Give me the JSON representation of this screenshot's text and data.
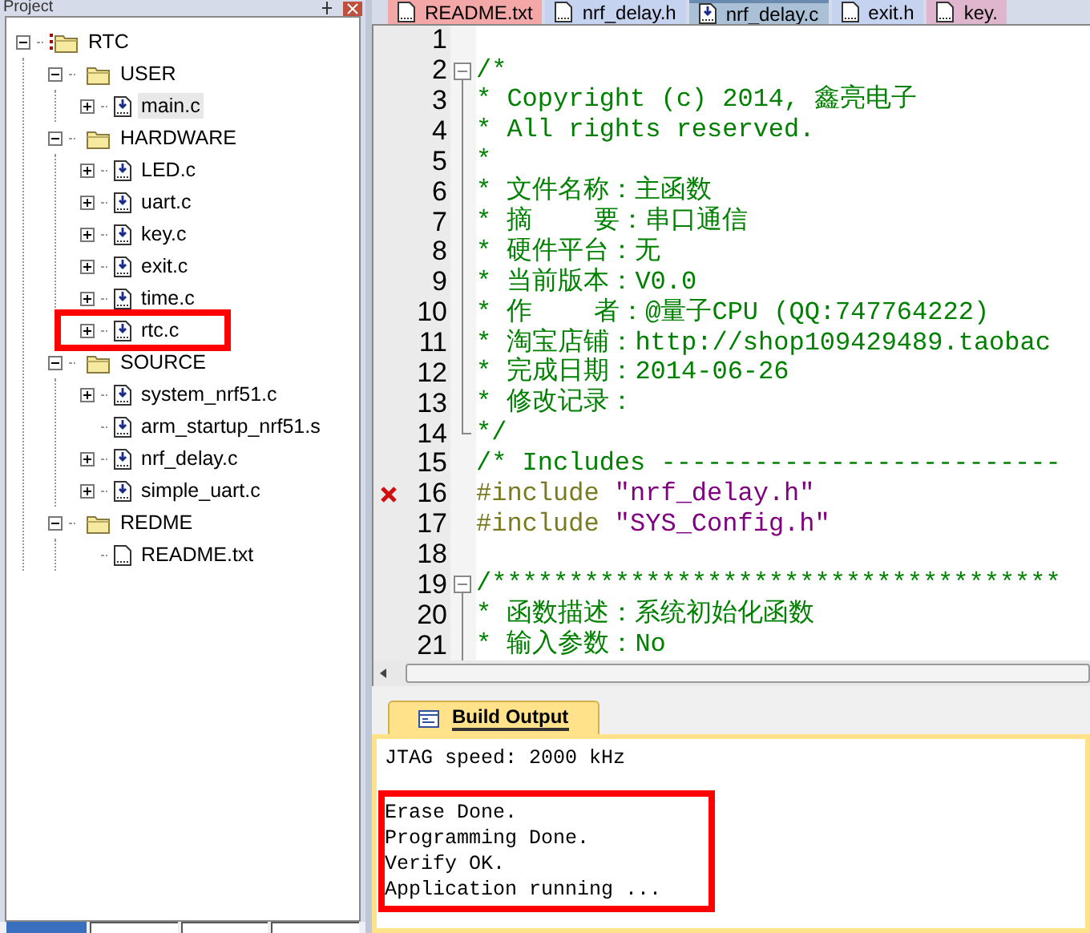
{
  "project_panel": {
    "title": "Project",
    "tree": [
      {
        "label": "RTC",
        "kind": "project",
        "expandable": true,
        "expanded": true,
        "selected": false,
        "annotated": false,
        "children": [
          {
            "label": "USER",
            "kind": "folder",
            "expandable": true,
            "expanded": true,
            "selected": false,
            "annotated": false,
            "children": [
              {
                "label": "main.c",
                "kind": "source",
                "expandable": true,
                "expanded": false,
                "selected": true,
                "annotated": false
              }
            ]
          },
          {
            "label": "HARDWARE",
            "kind": "folder",
            "expandable": true,
            "expanded": true,
            "selected": false,
            "annotated": false,
            "children": [
              {
                "label": "LED.c",
                "kind": "source",
                "expandable": true,
                "expanded": false,
                "selected": false,
                "annotated": false
              },
              {
                "label": "uart.c",
                "kind": "source",
                "expandable": true,
                "expanded": false,
                "selected": false,
                "annotated": false
              },
              {
                "label": "key.c",
                "kind": "source",
                "expandable": true,
                "expanded": false,
                "selected": false,
                "annotated": false
              },
              {
                "label": "exit.c",
                "kind": "source",
                "expandable": true,
                "expanded": false,
                "selected": false,
                "annotated": false
              },
              {
                "label": "time.c",
                "kind": "source",
                "expandable": true,
                "expanded": false,
                "selected": false,
                "annotated": false
              },
              {
                "label": "rtc.c",
                "kind": "source",
                "expandable": true,
                "expanded": false,
                "selected": false,
                "annotated": true
              }
            ]
          },
          {
            "label": "SOURCE",
            "kind": "folder",
            "expandable": true,
            "expanded": true,
            "selected": false,
            "annotated": false,
            "children": [
              {
                "label": "system_nrf51.c",
                "kind": "source",
                "expandable": true,
                "expanded": false,
                "selected": false,
                "annotated": false
              },
              {
                "label": "arm_startup_nrf51.s",
                "kind": "source",
                "expandable": false,
                "selected": false,
                "annotated": false
              },
              {
                "label": "nrf_delay.c",
                "kind": "source",
                "expandable": true,
                "expanded": false,
                "selected": false,
                "annotated": false
              },
              {
                "label": "simple_uart.c",
                "kind": "source",
                "expandable": true,
                "expanded": false,
                "selected": false,
                "annotated": false
              }
            ]
          },
          {
            "label": "REDME",
            "kind": "folder",
            "expandable": true,
            "expanded": true,
            "selected": false,
            "annotated": false,
            "children": [
              {
                "label": "README.txt",
                "kind": "text",
                "expandable": false,
                "selected": false,
                "annotated": false
              }
            ]
          }
        ]
      }
    ]
  },
  "editor": {
    "tabs": [
      {
        "label": "README.txt",
        "kind": "text",
        "selected": false,
        "color": "#f4a7a7"
      },
      {
        "label": "nrf_delay.h",
        "kind": "text",
        "selected": false,
        "color": "#c5d3f0"
      },
      {
        "label": "nrf_delay.c",
        "kind": "source",
        "selected": true,
        "color": "#a9c0d6"
      },
      {
        "label": "exit.h",
        "kind": "text",
        "selected": false,
        "color": "#c5d3f0"
      },
      {
        "label": "key.",
        "kind": "text",
        "selected": false,
        "color": "#e0b6cf"
      }
    ],
    "lines": [
      {
        "number": "1",
        "kind": "blank",
        "fold_start": false,
        "fold_body": false,
        "fold_end": false,
        "error": false
      },
      {
        "number": "2",
        "kind": "comment",
        "text": "/*",
        "fold_start": true,
        "fold_body": false,
        "fold_end": false,
        "error": false
      },
      {
        "number": "3",
        "kind": "comment",
        "text": "* Copyright (c) 2014, 鑫亮电子",
        "fold_start": false,
        "fold_body": true,
        "fold_end": false,
        "error": false
      },
      {
        "number": "4",
        "kind": "comment",
        "text": "* All rights reserved.",
        "fold_start": false,
        "fold_body": true,
        "fold_end": false,
        "error": false
      },
      {
        "number": "5",
        "kind": "comment",
        "text": "*",
        "fold_start": false,
        "fold_body": true,
        "fold_end": false,
        "error": false
      },
      {
        "number": "6",
        "kind": "comment",
        "text": "* 文件名称：主函数",
        "fold_start": false,
        "fold_body": true,
        "fold_end": false,
        "error": false
      },
      {
        "number": "7",
        "kind": "comment",
        "text": "* 摘    要：串口通信",
        "fold_start": false,
        "fold_body": true,
        "fold_end": false,
        "error": false
      },
      {
        "number": "8",
        "kind": "comment",
        "text": "* 硬件平台：无",
        "fold_start": false,
        "fold_body": true,
        "fold_end": false,
        "error": false
      },
      {
        "number": "9",
        "kind": "comment",
        "text": "* 当前版本：V0.0",
        "fold_start": false,
        "fold_body": true,
        "fold_end": false,
        "error": false
      },
      {
        "number": "10",
        "kind": "comment",
        "text": "* 作    者：@量子CPU (QQ:747764222)",
        "fold_start": false,
        "fold_body": true,
        "fold_end": false,
        "error": false
      },
      {
        "number": "11",
        "kind": "comment",
        "text": "* 淘宝店铺：http://shop109429489.taobac",
        "fold_start": false,
        "fold_body": true,
        "fold_end": false,
        "error": false
      },
      {
        "number": "12",
        "kind": "comment",
        "text": "* 完成日期：2014-06-26",
        "fold_start": false,
        "fold_body": true,
        "fold_end": false,
        "error": false
      },
      {
        "number": "13",
        "kind": "comment",
        "text": "* 修改记录：",
        "fold_start": false,
        "fold_body": true,
        "fold_end": false,
        "error": false
      },
      {
        "number": "14",
        "kind": "comment",
        "text": "*/",
        "fold_start": false,
        "fold_body": false,
        "fold_end": true,
        "error": false
      },
      {
        "number": "15",
        "kind": "comment",
        "text": "/* Includes --------------------------",
        "fold_start": false,
        "fold_body": false,
        "fold_end": false,
        "error": false
      },
      {
        "number": "16",
        "kind": "include",
        "directive": "#include",
        "path": "\"nrf_delay.h\"",
        "fold_start": false,
        "fold_body": false,
        "fold_end": false,
        "error": true
      },
      {
        "number": "17",
        "kind": "include",
        "directive": "#include",
        "path": "\"SYS_Config.h\"",
        "fold_start": false,
        "fold_body": false,
        "fold_end": false,
        "error": false
      },
      {
        "number": "18",
        "kind": "blank",
        "fold_start": false,
        "fold_body": false,
        "fold_end": false,
        "error": false
      },
      {
        "number": "19",
        "kind": "comment",
        "text": "/*************************************",
        "fold_start": true,
        "fold_body": false,
        "fold_end": false,
        "error": false
      },
      {
        "number": "20",
        "kind": "comment",
        "text": "* 函数描述：系统初始化函数",
        "fold_start": false,
        "fold_body": true,
        "fold_end": false,
        "error": false
      },
      {
        "number": "21",
        "kind": "comment",
        "text": "* 输入参数：No",
        "fold_start": false,
        "fold_body": true,
        "fold_end": false,
        "error": false
      }
    ]
  },
  "panel_tabs": [
    {
      "selected": true
    },
    {
      "selected": false
    },
    {
      "selected": false
    },
    {
      "selected": false
    }
  ],
  "output": {
    "tab": "Build Output",
    "groups": [
      {
        "annotated": false,
        "lines": [
          "JTAG speed: 2000 kHz"
        ]
      },
      {
        "annotated": true,
        "lines": [
          "Erase Done.",
          "Programming Done.",
          "Verify OK.",
          "Application running ..."
        ]
      }
    ]
  }
}
